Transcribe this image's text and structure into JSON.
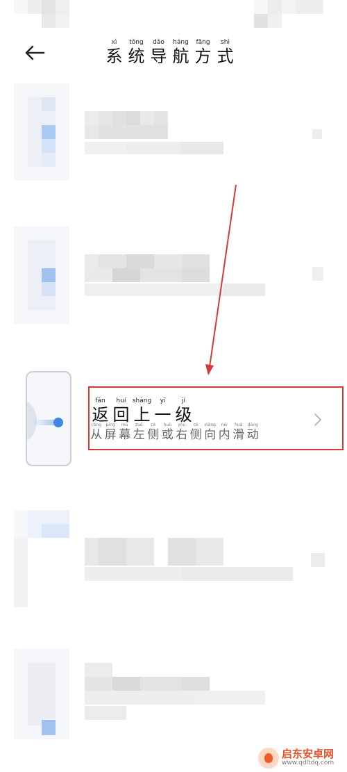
{
  "header": {
    "back_icon": "arrow-left-icon",
    "title_chars": [
      {
        "py": "xì",
        "hz": "系"
      },
      {
        "py": "tǒng",
        "hz": "统"
      },
      {
        "py": "dǎo",
        "hz": "导"
      },
      {
        "py": "háng",
        "hz": "航"
      },
      {
        "py": "fāng",
        "hz": "方"
      },
      {
        "py": "shì",
        "hz": "式"
      }
    ]
  },
  "highlighted_item": {
    "title_chars": [
      {
        "py": "fǎn",
        "hz": "返"
      },
      {
        "py": "huí",
        "hz": "回"
      },
      {
        "py": "shàng",
        "hz": "上"
      },
      {
        "py": "yī",
        "hz": "一"
      },
      {
        "py": "jí",
        "hz": "级"
      }
    ],
    "subtitle_chars": [
      {
        "py": "cóng",
        "hz": "从"
      },
      {
        "py": "píng",
        "hz": "屏"
      },
      {
        "py": "mù",
        "hz": "幕"
      },
      {
        "py": "zuǒ",
        "hz": "左"
      },
      {
        "py": "cè",
        "hz": "侧"
      },
      {
        "py": "huò",
        "hz": "或"
      },
      {
        "py": "yòu",
        "hz": "右"
      },
      {
        "py": "cè",
        "hz": "侧"
      },
      {
        "py": "xiàng",
        "hz": "向"
      },
      {
        "py": "nèi",
        "hz": "内"
      },
      {
        "py": "huá",
        "hz": "滑"
      },
      {
        "py": "dòng",
        "hz": "动"
      }
    ],
    "chevron_icon": "chevron-right-icon",
    "preview_icon": "phone-gesture-preview"
  },
  "colors": {
    "highlight_border": "#d33a35",
    "arrow": "#d33a35",
    "accent_blue": "#3f86e0"
  },
  "watermark": {
    "name": "启东安卓网",
    "url": "www.qdltdq.com"
  }
}
